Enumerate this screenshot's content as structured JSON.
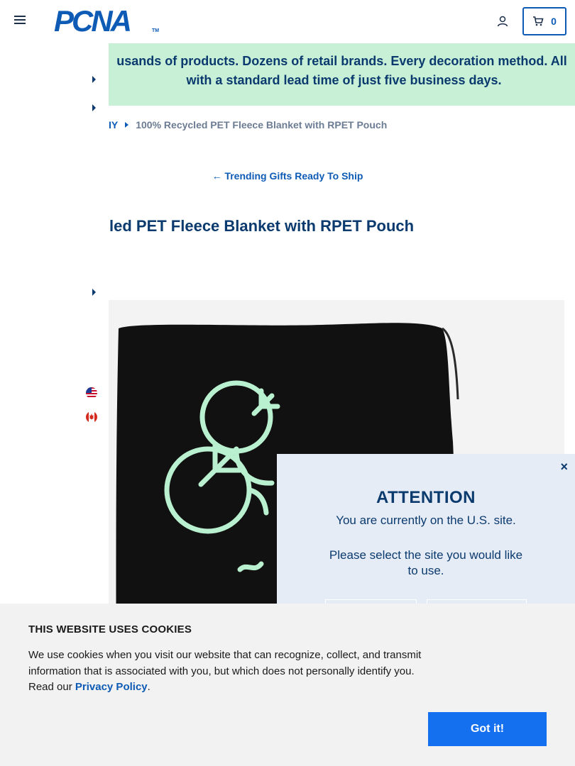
{
  "header": {
    "logo_text": "PCNA",
    "logo_tm": "TM",
    "cart_count": "0"
  },
  "banner": {
    "line1": "usands of products. Dozens of retail brands. Every decoration method. All",
    "line2": "with a standard lead time of just five business days."
  },
  "breadcrumb": {
    "previous": "IY",
    "current": "100% Recycled PET Fleece Blanket with RPET Pouch"
  },
  "back_link": "Trending Gifts Ready To Ship",
  "product": {
    "title": "led PET Fleece Blanket with RPET Pouch"
  },
  "attention_modal": {
    "title": "ATTENTION",
    "line1": "You are currently on the U.S. site.",
    "line2": "Please select the site you would like to use.",
    "close": "×"
  },
  "cookie_banner": {
    "title": "THIS WEBSITE USES COOKIES",
    "text": "We use cookies when you visit our website that can recognize, collect, and transmit information that is associated with you, but which does not personally identify you. Read our",
    "link": "Privacy Policy",
    "period": ".",
    "button": "Got it!"
  },
  "icons": {
    "menu": "hamburger-icon",
    "account": "user-icon",
    "cart": "cart-icon",
    "back": "arrow-left-icon",
    "flag_us": "us-flag-icon",
    "flag_ca": "canada-flag-icon"
  },
  "colors": {
    "brand_blue": "#0d5bb5",
    "navy": "#0b3a6e",
    "banner_green": "#c8f0d6",
    "modal_bg": "#e6ecf6",
    "cookie_button": "#1570ef"
  }
}
